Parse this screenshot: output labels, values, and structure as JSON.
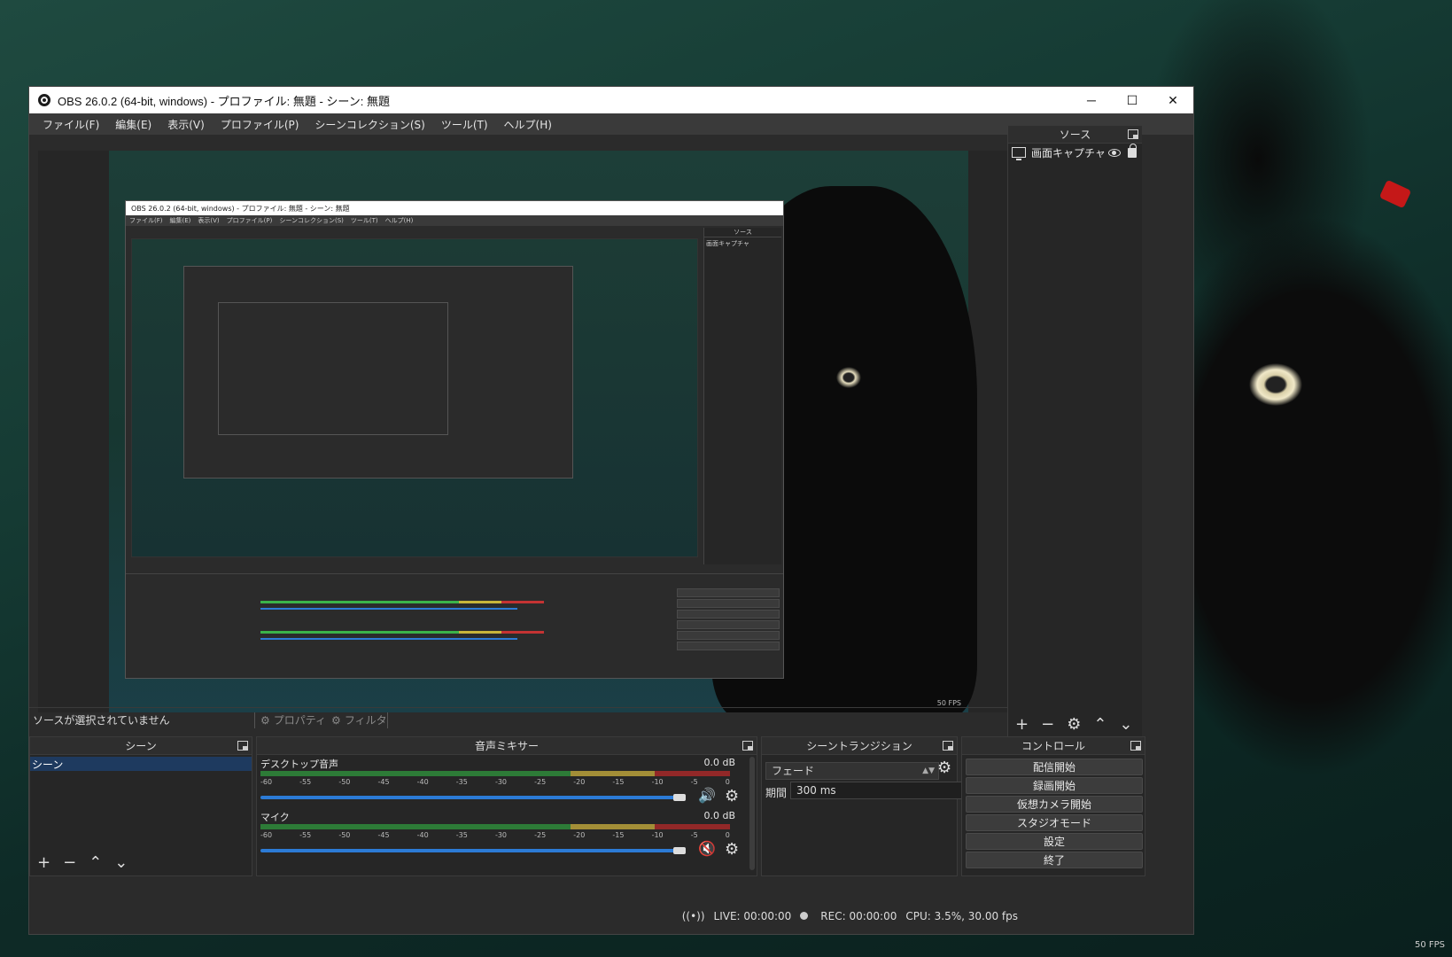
{
  "window": {
    "title": "OBS 26.0.2 (64-bit, windows) - プロファイル: 無題 - シーン: 無題",
    "minimize": "─",
    "maximize": "☐",
    "close": "✕"
  },
  "menu": [
    "ファイル(F)",
    "編集(E)",
    "表示(V)",
    "プロファイル(P)",
    "シーンコレクション(S)",
    "ツール(T)",
    "ヘルプ(H)"
  ],
  "sources": {
    "title": "ソース",
    "items": [
      {
        "label": "画面キャプチャ",
        "icon": "monitor-icon"
      }
    ]
  },
  "status": {
    "no_source": "ソースが選択されていません",
    "properties": "プロパティ",
    "filters": "フィルタ"
  },
  "scenes": {
    "title": "シーン",
    "items": [
      "シーン"
    ]
  },
  "mixer": {
    "title": "音声ミキサー",
    "channels": [
      {
        "name": "デスクトップ音声",
        "db": "0.0 dB",
        "muted": false
      },
      {
        "name": "マイク",
        "db": "0.0 dB",
        "muted": true
      }
    ],
    "scale": [
      "-60",
      "-55",
      "-50",
      "-45",
      "-40",
      "-35",
      "-30",
      "-25",
      "-20",
      "-15",
      "-10",
      "-5",
      "0"
    ]
  },
  "transition": {
    "title": "シーントランジション",
    "type": "フェード",
    "duration_label": "期間",
    "duration": "300 ms"
  },
  "controls": {
    "title": "コントロール",
    "buttons": [
      "配信開始",
      "録画開始",
      "仮想カメラ開始",
      "スタジオモード",
      "設定",
      "終了"
    ]
  },
  "footer": {
    "live": "LIVE: 00:00:00",
    "rec": "REC: 00:00:00",
    "cpu": "CPU: 3.5%, 30.00 fps"
  },
  "desktop": {
    "fps": "50 FPS"
  },
  "nested": {
    "title": "OBS 26.0.2 (64-bit, windows) - プロファイル: 無題 - シーン: 無題",
    "fps": "50 FPS"
  },
  "colors": {
    "accent": "#2c7bd6",
    "window_bg": "#2b2b2b",
    "muted": "#d42020"
  }
}
